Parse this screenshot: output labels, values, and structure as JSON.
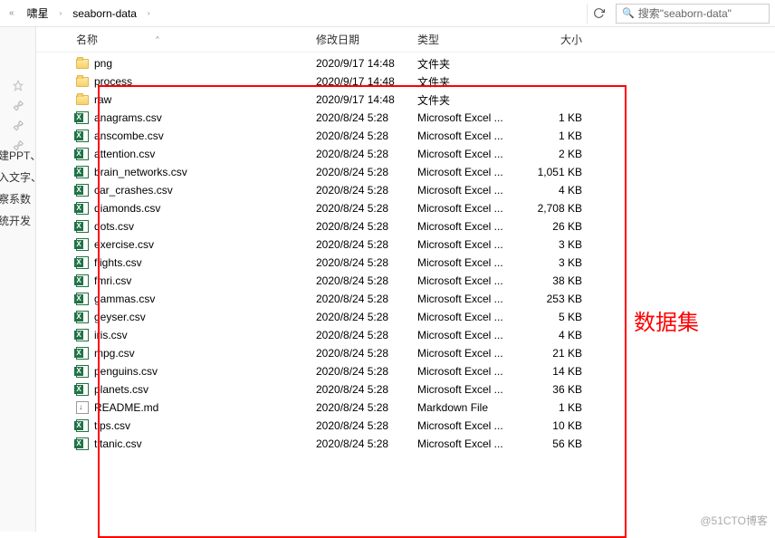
{
  "breadcrumb": {
    "part1": "啸星",
    "sep": "›",
    "part2": "seaborn-data",
    "tail": "›"
  },
  "search": {
    "placeholder": "搜索\"seaborn-data\""
  },
  "columns": {
    "name": "名称",
    "date": "修改日期",
    "type": "类型",
    "size": "大小",
    "sort": "^"
  },
  "sidecut": {
    "l1": "建PPT、",
    "l2": "入文字、",
    "l3": "察系数",
    "l4": "统开发"
  },
  "files": [
    {
      "icon": "folder",
      "name": "png",
      "date": "2020/9/17 14:48",
      "type": "文件夹",
      "size": ""
    },
    {
      "icon": "folder",
      "name": "process",
      "date": "2020/9/17 14:48",
      "type": "文件夹",
      "size": ""
    },
    {
      "icon": "folder",
      "name": "raw",
      "date": "2020/9/17 14:48",
      "type": "文件夹",
      "size": ""
    },
    {
      "icon": "excel",
      "name": "anagrams.csv",
      "date": "2020/8/24 5:28",
      "type": "Microsoft Excel ...",
      "size": "1 KB"
    },
    {
      "icon": "excel",
      "name": "anscombe.csv",
      "date": "2020/8/24 5:28",
      "type": "Microsoft Excel ...",
      "size": "1 KB"
    },
    {
      "icon": "excel",
      "name": "attention.csv",
      "date": "2020/8/24 5:28",
      "type": "Microsoft Excel ...",
      "size": "2 KB"
    },
    {
      "icon": "excel",
      "name": "brain_networks.csv",
      "date": "2020/8/24 5:28",
      "type": "Microsoft Excel ...",
      "size": "1,051 KB"
    },
    {
      "icon": "excel",
      "name": "car_crashes.csv",
      "date": "2020/8/24 5:28",
      "type": "Microsoft Excel ...",
      "size": "4 KB"
    },
    {
      "icon": "excel",
      "name": "diamonds.csv",
      "date": "2020/8/24 5:28",
      "type": "Microsoft Excel ...",
      "size": "2,708 KB"
    },
    {
      "icon": "excel",
      "name": "dots.csv",
      "date": "2020/8/24 5:28",
      "type": "Microsoft Excel ...",
      "size": "26 KB"
    },
    {
      "icon": "excel",
      "name": "exercise.csv",
      "date": "2020/8/24 5:28",
      "type": "Microsoft Excel ...",
      "size": "3 KB"
    },
    {
      "icon": "excel",
      "name": "flights.csv",
      "date": "2020/8/24 5:28",
      "type": "Microsoft Excel ...",
      "size": "3 KB"
    },
    {
      "icon": "excel",
      "name": "fmri.csv",
      "date": "2020/8/24 5:28",
      "type": "Microsoft Excel ...",
      "size": "38 KB"
    },
    {
      "icon": "excel",
      "name": "gammas.csv",
      "date": "2020/8/24 5:28",
      "type": "Microsoft Excel ...",
      "size": "253 KB"
    },
    {
      "icon": "excel",
      "name": "geyser.csv",
      "date": "2020/8/24 5:28",
      "type": "Microsoft Excel ...",
      "size": "5 KB"
    },
    {
      "icon": "excel",
      "name": "iris.csv",
      "date": "2020/8/24 5:28",
      "type": "Microsoft Excel ...",
      "size": "4 KB"
    },
    {
      "icon": "excel",
      "name": "mpg.csv",
      "date": "2020/8/24 5:28",
      "type": "Microsoft Excel ...",
      "size": "21 KB"
    },
    {
      "icon": "excel",
      "name": "penguins.csv",
      "date": "2020/8/24 5:28",
      "type": "Microsoft Excel ...",
      "size": "14 KB"
    },
    {
      "icon": "excel",
      "name": "planets.csv",
      "date": "2020/8/24 5:28",
      "type": "Microsoft Excel ...",
      "size": "36 KB"
    },
    {
      "icon": "md",
      "name": "README.md",
      "date": "2020/8/24 5:28",
      "type": "Markdown File",
      "size": "1 KB"
    },
    {
      "icon": "excel",
      "name": "tips.csv",
      "date": "2020/8/24 5:28",
      "type": "Microsoft Excel ...",
      "size": "10 KB"
    },
    {
      "icon": "excel",
      "name": "titanic.csv",
      "date": "2020/8/24 5:28",
      "type": "Microsoft Excel ...",
      "size": "56 KB"
    }
  ],
  "annotation": "数据集",
  "watermark": "@51CTO博客"
}
